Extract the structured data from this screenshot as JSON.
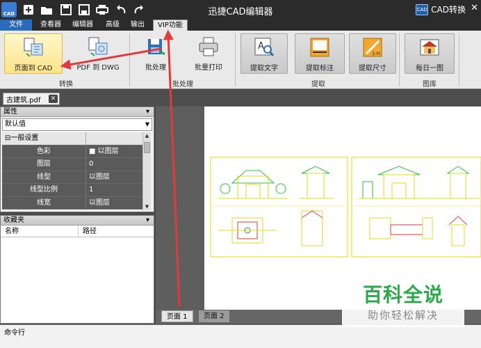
{
  "app": {
    "title": "迅捷CAD编辑器",
    "logo_text": "CAD",
    "cad_convert_label": "CAD转换",
    "cad_badge": "CAD"
  },
  "quick_access": [
    "new-icon",
    "open-folder-icon",
    "save-icon",
    "save-as-icon",
    "print-icon",
    "undo-icon",
    "redo-icon"
  ],
  "menu": {
    "file": "文件",
    "viewer": "查看器",
    "editor": "编辑器",
    "advanced": "高级",
    "output": "输出",
    "vip": "VIP功能"
  },
  "ribbon": {
    "groups": {
      "convert": "转换",
      "batch": "批处理",
      "extract": "提取",
      "gallery": "图库"
    },
    "buttons": {
      "page_to_cad": "页面到 CAD",
      "pdf_to_dwg": "PDF 到 DWG",
      "batch_process": "批处理",
      "batch_print": "批量打印",
      "extract_text": "提取文字",
      "extract_annotation": "提取标注",
      "extract_dimension": "提取尺寸",
      "daily_drawing": "每日一图"
    },
    "dimension_icon_text": "1:H"
  },
  "document_tab": {
    "filename": "古建筑.pdf",
    "close": "✕"
  },
  "properties": {
    "title": "属性",
    "pin": "ᵖ",
    "dropdown_value": "默认值",
    "category": "一般设置",
    "category_toggle": "⊟",
    "rows": [
      {
        "key": "色彩",
        "value": "■ 以图层"
      },
      {
        "key": "图层",
        "value": "0"
      },
      {
        "key": "线型",
        "value": "以图层"
      },
      {
        "key": "线型比例",
        "value": "1"
      },
      {
        "key": "线宽",
        "value": "以图层"
      }
    ]
  },
  "favorites": {
    "title": "收藏夹",
    "pin": "ᵖ",
    "col_name": "名称",
    "col_path": "路径"
  },
  "page_tabs": {
    "page1": "页面 1",
    "page2": "页面 2"
  },
  "command_line": {
    "label": "命令行"
  },
  "watermark": {
    "title": "百科全说",
    "subtitle": "助你轻松解决"
  },
  "colors": {
    "accent_blue": "#2a6bbd",
    "highlight": "#ffe38a",
    "annotation_red": "#e23a3a",
    "drawing_line": "#d9e21a",
    "drawing_green": "#2fbf3a"
  }
}
